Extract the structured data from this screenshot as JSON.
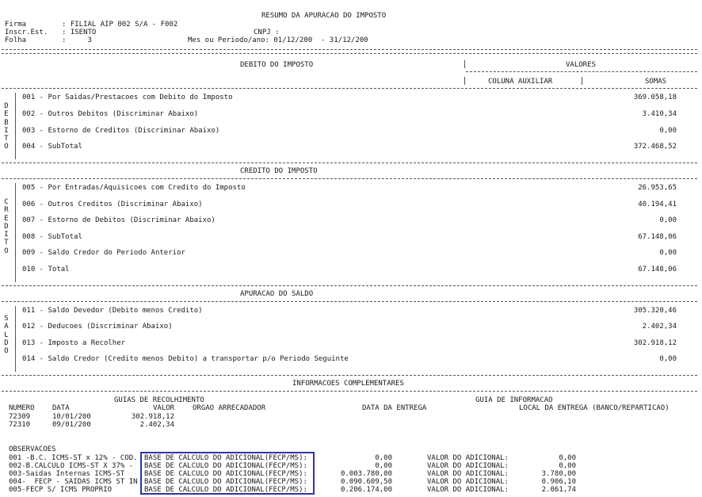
{
  "header": {
    "title": "RESUMO DA APURACAO DO IMPOSTO",
    "firma_label": "Firma",
    "firma_value": ": FILIAL AIP 002 S/A - F002",
    "insc_label": "Inscr.Est.",
    "insc_value": ": ISENTO",
    "cnpj_label": "CNPJ :",
    "folha_label": "Folha",
    "folha_value": ":     3",
    "periodo": "Mes ou Periodo/ano: 01/12/200  - 31/12/200"
  },
  "columns": {
    "debito_title": "DEBITO DO IMPOSTO",
    "valores": "VALORES",
    "coluna_auxiliar": "COLUNA AUXILIAR",
    "somas": "SOMAS"
  },
  "debito": {
    "side_label": "D\nE\nB\nI\nT\nO",
    "rows": [
      {
        "label": "001 - Por Saidas/Prestacoes com Debito do Imposto",
        "value": "369.058,18"
      },
      {
        "label": "002 - Outros Debitos (Discriminar Abaixo)",
        "value": "3.410,34"
      },
      {
        "label": "003 - Estorno de Creditos (Discriminar Abaixo)",
        "value": "0,00"
      },
      {
        "label": "004 - SubTotal",
        "value": "372.468,52"
      }
    ]
  },
  "credito": {
    "title": "CREDITO DO IMPOSTO",
    "side_label": "C\nR\nE\nD\nI\nT\nO",
    "rows": [
      {
        "label": "005 - Por Entradas/Aquisicoes com Credito do Imposto",
        "value": "26.953,65"
      },
      {
        "label": "006 - Outros Creditos (Discriminar Abaixo)",
        "value": "40.194,41"
      },
      {
        "label": "007 - Estorno de Debitos (Discriminar Abaixo)",
        "value": "0,00"
      },
      {
        "label": "008 - SubTotal",
        "value": "67.148,06"
      },
      {
        "label": "009 - Saldo Credor do Periodo Anterior",
        "value": "0,00"
      },
      {
        "label": "010 - Total",
        "value": "67.148,06"
      }
    ]
  },
  "saldo": {
    "title": "APURACAO DO SALDO",
    "side_label": "S\nA\nL\nD\nO",
    "rows": [
      {
        "label": "011 - Saldo Devedor (Debito menos Credito)",
        "value": "305.320,46"
      },
      {
        "label": "012 - Deducoes (Discriminar Abaixo)",
        "value": "2.402,34"
      },
      {
        "label": "013 - Imposto a Recolher",
        "value": "302.918,12"
      },
      {
        "label": "014 - Saldo Credor (Credito menos Debito) a transportar p/o Periodo Seguinte",
        "value": "0,00"
      }
    ]
  },
  "info": {
    "title": "INFORMACOES COMPLEMENTARES",
    "guias_title": "GUIAS DE RECOLHIMENTO",
    "guia_info_title": "GUIA DE INFORMACAO",
    "headers": {
      "numero": "NUMERO",
      "data": "DATA",
      "valor": "VALOR",
      "orgao": "ORGAO ARRECADADOR",
      "data_entrega": "DATA DA ENTREGA",
      "local_entrega": "LOCAL DA ENTREGA (BANCO/REPARTICAO)"
    },
    "guias": [
      {
        "numero": "72309",
        "data": "10/01/200",
        "valor": "302.918,12"
      },
      {
        "numero": "72310",
        "data": "09/01/200",
        "valor": "2.402,34"
      }
    ]
  },
  "observacoes": {
    "title": "OBSERVACOES",
    "rows": [
      {
        "desc": "001 -B.C. ICMS-ST x 12% - COD.",
        "base_label": "BASE DE CALCULO DO ADICIONAL(FECP/MS):",
        "base_value": "0,00",
        "adic_label": "VALOR DO ADICIONAL:",
        "adic_value": "0,00"
      },
      {
        "desc": "002-B.CALCULO ICMS-ST X 37% -",
        "base_label": "BASE DE CALCULO DO ADICIONAL(FECP/MS):",
        "base_value": "0,00",
        "adic_label": "VALOR DO ADICIONAL:",
        "adic_value": "0,00"
      },
      {
        "desc": "003-Saidas Internas ICMS-ST",
        "base_label": "BASE DE CALCULO DO ADICIONAL(FECP/MS):",
        "base_value": "0.003.780,00",
        "adic_label": "VALOR DO ADICIONAL:",
        "adic_value": "3.780,00"
      },
      {
        "desc": "004-  FECP - SAIDAS ICMS ST IN",
        "base_label": "BASE DE CALCULO DO ADICIONAL(FECP/MS):",
        "base_value": "0.090.609,50",
        "adic_label": "VALOR DO ADICIONAL:",
        "adic_value": "0.906,10"
      },
      {
        "desc": "005-FECP S/ ICMS PROPRIO",
        "base_label": "BASE DE CALCULO DO ADICIONAL(FECP/MS):",
        "base_value": "0.206.174,00",
        "adic_label": "VALOR DO ADICIONAL:",
        "adic_value": "2.061,74"
      }
    ]
  },
  "colors": {
    "highlight_border": "#2d35a8"
  }
}
